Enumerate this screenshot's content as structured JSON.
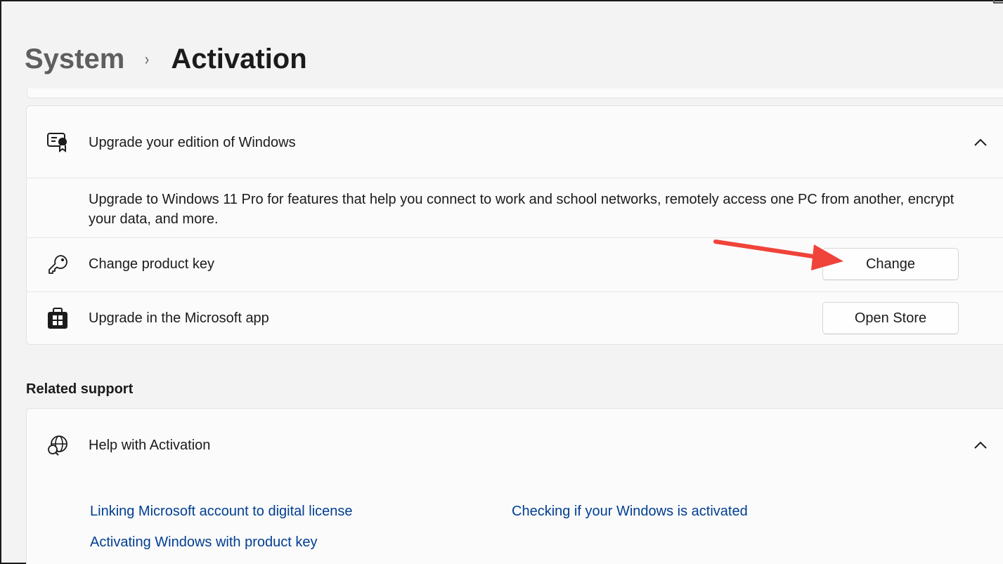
{
  "breadcrumb": {
    "parent": "System",
    "separator": "›",
    "current": "Activation"
  },
  "upgrade_card": {
    "header_label": "Upgrade your edition of Windows",
    "header_icon": "certificate-icon",
    "expanded": true,
    "description": "Upgrade to Windows 11 Pro for features that help you connect to work and school networks, remotely access one PC from another, encrypt your data, and more.",
    "rows": [
      {
        "icon": "key-icon",
        "label": "Change product key",
        "button": "Change"
      },
      {
        "icon": "store-icon",
        "label": "Upgrade in the Microsoft app",
        "button": "Open Store"
      }
    ]
  },
  "related_support": {
    "title": "Related support",
    "help_card": {
      "header_label": "Help with Activation",
      "header_icon": "globe-search-icon",
      "expanded": true,
      "links": [
        "Linking Microsoft account to digital license",
        "Checking if your Windows is activated",
        "Activating Windows with product key"
      ]
    }
  },
  "colors": {
    "accent_link": "#003e92",
    "annotation_arrow": "#f0433a",
    "background": "#f3f3f3",
    "card": "#fbfbfb"
  }
}
